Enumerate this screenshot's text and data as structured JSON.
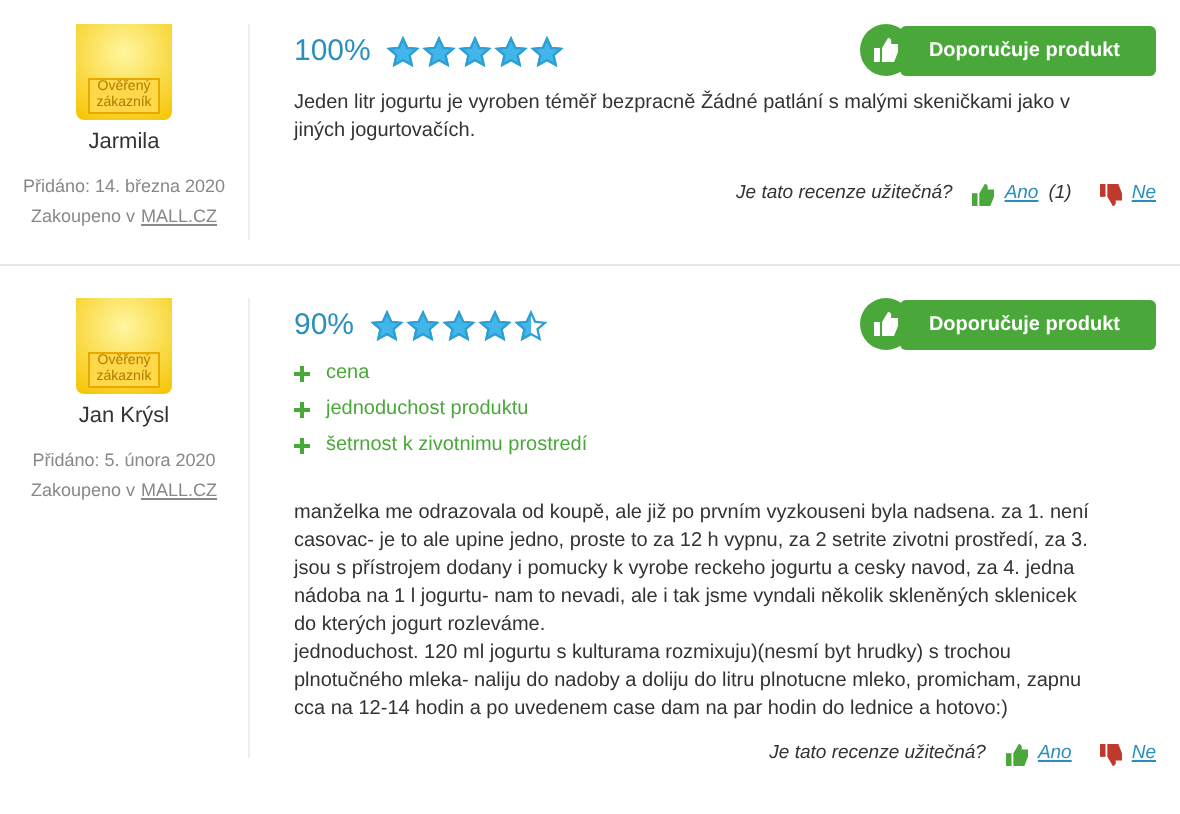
{
  "reviews": [
    {
      "badge": "Ověřený zákazník",
      "author": "Jarmila",
      "added": "Přidáno: 14. března 2020",
      "purchased_prefix": "Zakoupeno v",
      "shop": "MALL.CZ",
      "percent": "100%",
      "stars": 5,
      "recommends": "Doporučuje produkt",
      "text": "Jeden litr jogurtu je vyroben téměř bezpracně Žádné patlání s malými skeničkami jako v jiných jogurtovačích.",
      "helpful_question": "Je tato recenze užitečná?",
      "yes": "Ano",
      "yes_count": "(1)",
      "no": "Ne"
    },
    {
      "badge": "Ověřený zákazník",
      "author": "Jan Krýsl",
      "added": "Přidáno: 5. února 2020",
      "purchased_prefix": "Zakoupeno v",
      "shop": "MALL.CZ",
      "percent": "90%",
      "stars": 4.5,
      "recommends": "Doporučuje produkt",
      "pros": [
        "cena",
        "jednoduchost produktu",
        "šetrnost k zivotnimu prostredí"
      ],
      "text": "manželka me odrazovala od koupě, ale již po prvním vyzkouseni byla nadsena. za 1. není casovac- je to ale upine jedno, proste to za 12 h vypnu, za 2 setrite zivotni prostředí, za 3. jsou s přístrojem dodany i pomucky k vyrobe reckeho jogurtu a cesky navod, za 4. jedna nádoba na 1 l jogurtu- nam to nevadi, ale i tak jsme vyndali několik skleněných sklenicek do kterých jogurt rozleváme.\njednoduchost. 120 ml jogurtu s kulturama rozmixuju)(nesmí byt hrudky) s trochou plnotučného mleka- naliju do nadoby a doliju do litru plnotucne mleko, promicham, zapnu cca na 12-14 hodin a po uvedenem case dam na par hodin do lednice a hotovo:)",
      "helpful_question": "Je tato recenze užitečná?",
      "yes": "Ano",
      "no": "Ne"
    }
  ]
}
